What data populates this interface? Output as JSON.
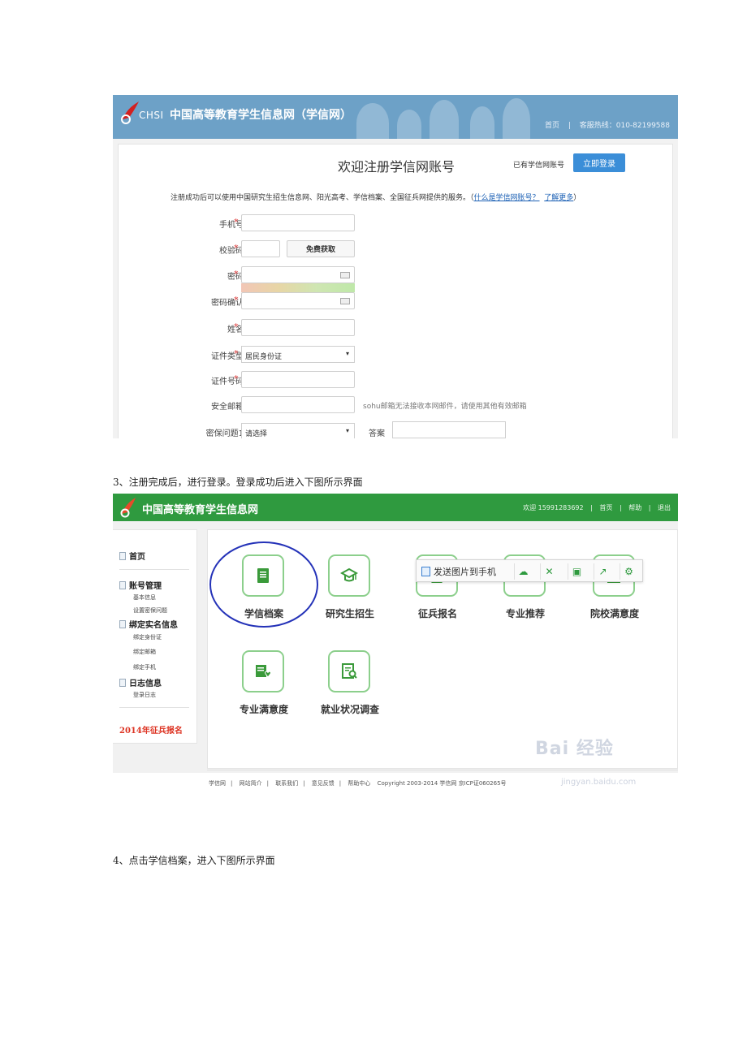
{
  "registration": {
    "brand": "CHSI",
    "site_name": "中国高等教育学生信息网（学信网）",
    "top_nav": {
      "home": "首页",
      "sep": "|",
      "hotline": "客服热线：010-82199588"
    },
    "title": "欢迎注册学信网账号",
    "already_have": "已有学信网账号",
    "login_button": "立即登录",
    "note_text": "注册成功后可以使用中国研究生招生信息网、阳光高考、学信档案、全国征兵网提供的服务。（",
    "note_link1": "什么是学信网账号？",
    "note_link2": "了解更多",
    "note_end": "）",
    "fields": {
      "phone": "手机号",
      "code": "校验码",
      "get_code": "免费获取",
      "password": "密码",
      "password_confirm": "密码确认",
      "name": "姓名",
      "id_type": "证件类型",
      "id_type_value": "居民身份证",
      "id_number": "证件号码",
      "email": "安全邮箱",
      "email_hint": "sohu邮箱无法接收本网邮件，请使用其他有效邮箱",
      "question1": "密保问题1",
      "question1_value": "请选择",
      "answer": "答案",
      "required_mark": "*",
      "select_arrow": "▾"
    }
  },
  "caption3": "3、注册完成后，进行登录。登录成功后进入下图所示界面",
  "dashboard": {
    "site_name": "中国高等教育学生信息网",
    "top_nav": {
      "welcome": "欢迎 15991283692",
      "home": "首页",
      "help": "帮助",
      "logout": "退出",
      "sep": "|"
    },
    "sidebar": {
      "home": "首页",
      "account": "账号管理",
      "basic_info": "基本信息",
      "security_q": "设置密保问题",
      "real_name": "绑定实名信息",
      "bind_id": "绑定身份证",
      "bind_email": "绑定邮箱",
      "bind_phone": "绑定手机",
      "log": "日志信息",
      "login_log": "登录日志",
      "recruit": "2014年征兵报名"
    },
    "tiles": [
      "学信档案",
      "研究生招生",
      "征兵报名",
      "专业推荐",
      "院校满意度",
      "专业满意度",
      "就业状况调查"
    ],
    "share_bar": {
      "label": "发送图片到手机"
    },
    "footer": {
      "items": [
        "学信网",
        "网站简介",
        "联系我们",
        "意见反馈",
        "帮助中心"
      ],
      "sep": "|",
      "copyright": "Copyright 2003-2014 学信网 京ICP证060265号"
    },
    "watermark": "Bai 经验",
    "watermark_url": "jingyan.baidu.com"
  },
  "caption4": "4、点击学信档案，进入下图所示界面",
  "colors": {
    "blue_header": "#6da1c7",
    "green_header": "#2f9a3f",
    "login_btn": "#3b8ed8",
    "circle": "#2432b8"
  }
}
